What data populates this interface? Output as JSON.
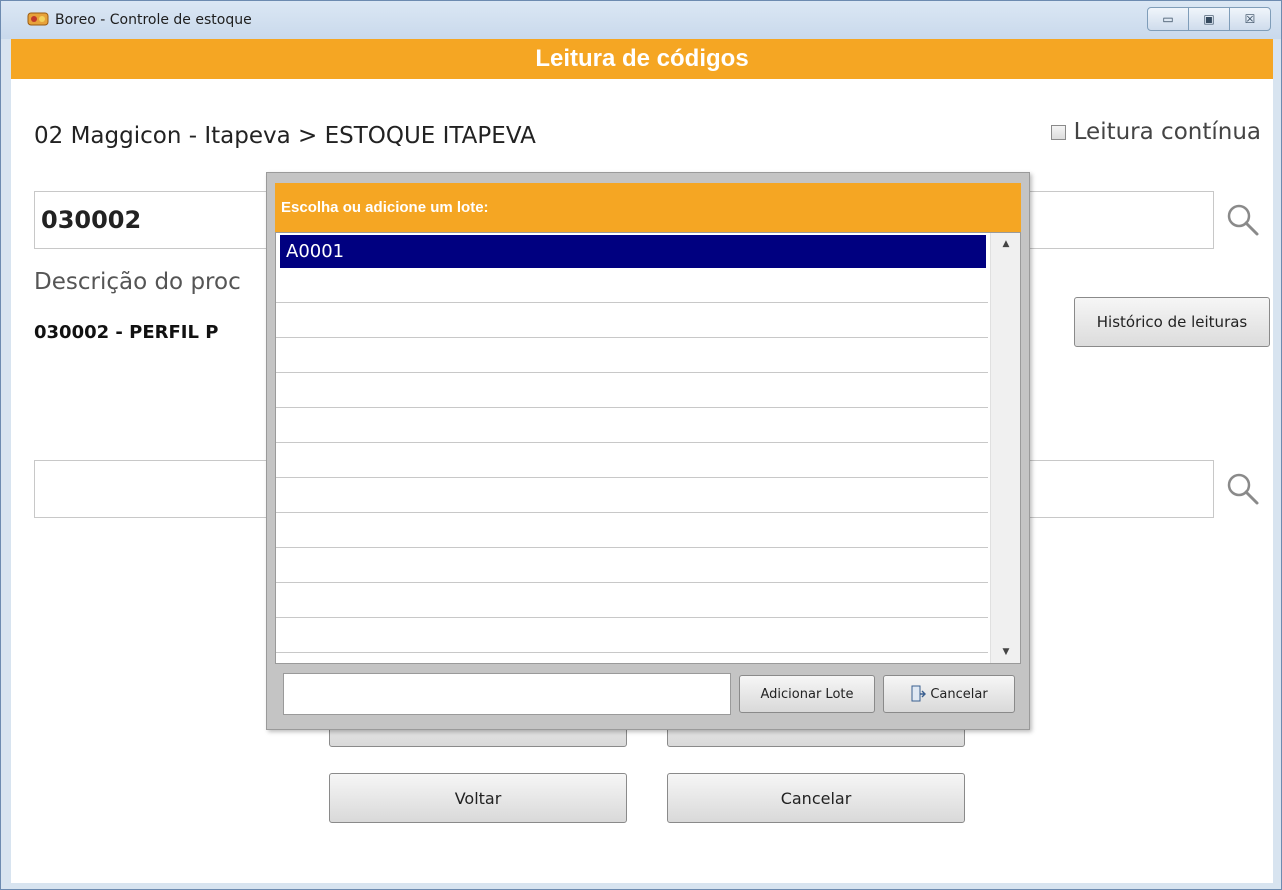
{
  "window": {
    "title": "Boreo - Controle de estoque",
    "minimize_glyph": "▭",
    "maximize_glyph": "▣",
    "close_glyph": "☒"
  },
  "header": {
    "title": "Leitura de códigos"
  },
  "location": "02 Maggicon - Itapeva > ESTOQUE ITAPEVA",
  "continuous_read": {
    "label": "Leitura contínua",
    "checked": false
  },
  "product_code": {
    "value": "030002"
  },
  "description": {
    "label": "Descrição do proc",
    "value": "030002 - PERFIL P"
  },
  "history_button": {
    "label": "Histórico de leituras"
  },
  "lot_field": {
    "value": ""
  },
  "buttons": {
    "back": "Voltar",
    "cancel": "Cancelar"
  },
  "modal": {
    "title": "Escolha ou adicione um lote:",
    "lots": [
      "A0001",
      "",
      "",
      "",
      "",
      "",
      "",
      "",
      "",
      "",
      "",
      ""
    ],
    "selected_index": 0,
    "new_lot_value": "",
    "add_button": "Adicionar Lote",
    "cancel_button": "Cancelar"
  },
  "colors": {
    "accent": "#f5a623",
    "selection": "#000080"
  }
}
